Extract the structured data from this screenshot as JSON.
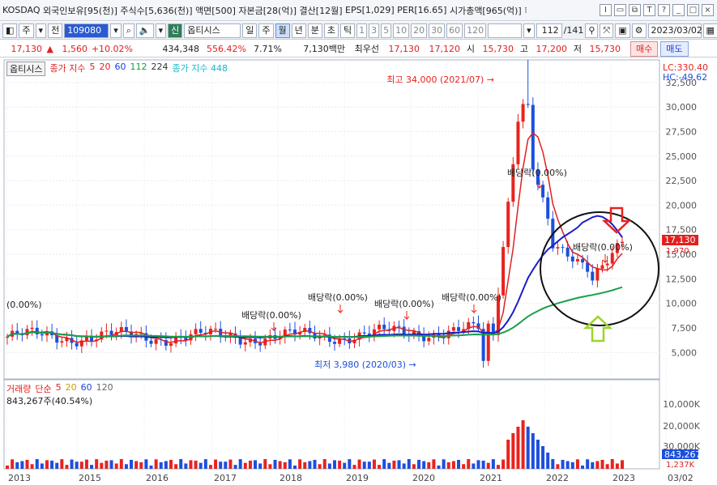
{
  "info": {
    "market": "KOSDAQ",
    "foreign": "외국인보유[95(천)]",
    "shares": "주식수[5,636(천)]",
    "par": "액면[500]",
    "capital": "자본금[28(억)]",
    "settle": "결산[12월]",
    "eps": "EPS[1,029]",
    "per": "PER[16.65]",
    "mcap": "시가총액[965(억)]",
    "tail": "⁝"
  },
  "toolbar": {
    "period_btn": "주",
    "prev_btn": "전",
    "code": "109080",
    "name": "옵티시스",
    "tag": "신",
    "periods": [
      "일",
      "주",
      "월",
      "년",
      "분",
      "초",
      "틱"
    ],
    "selected_period": "월",
    "nums": [
      "1",
      "3",
      "5",
      "10",
      "20",
      "30",
      "60",
      "120"
    ],
    "count": "112",
    "total": "/141",
    "date": "2023/03/02"
  },
  "quote": {
    "price": "17,130",
    "arrow": "▲",
    "change": "1,560",
    "rate": "+10.02%",
    "volume": "434,348",
    "vol_rate": "556.42%",
    "turnover": "7.71%",
    "amount": "7,130백만",
    "best_label": "최우선",
    "ask": "17,130",
    "bid": "17,120",
    "open_label": "시",
    "open": "15,730",
    "high_label": "고",
    "high": "17,200",
    "low_label": "저",
    "low": "15,730",
    "buy": "매수",
    "sell": "매도"
  },
  "legend": {
    "name": "옵티시스",
    "ma_label": "종가 지수",
    "ma": [
      "5",
      "20",
      "60",
      "112",
      "224"
    ],
    "ma2": "종가 지수 448"
  },
  "volume_legend": {
    "title": "거래량",
    "ma_label": "단순",
    "ma": [
      "5",
      "20",
      "60",
      "120"
    ],
    "current": "843,267주(40.54%)"
  },
  "annotations": {
    "high": "최고 34,000 (2021/07)",
    "low": "최저 3,980 (2020/03)",
    "div": "배당락(0.00%)",
    "first": "(0.00%)",
    "lc": "LC:330.40",
    "hc": "HC:-49.62",
    "price_tag": "17,130",
    "sub_tag": "1,970",
    "vol_tag": "843,267",
    "vol_tag2": "1,237K"
  },
  "colors": {
    "up": "#e8231e",
    "down": "#1d4fdc",
    "ma5": "#e02020",
    "ma20": "#1d1dc8",
    "ma60": "#18a048",
    "ma112": "#2a36b8",
    "accent": "#2a5bd0"
  },
  "chart_data": {
    "type": "candlestick",
    "x_labels": [
      "2013",
      "2015",
      "2016",
      "2017",
      "2018",
      "2019",
      "2020",
      "2021",
      "2022",
      "2023",
      "03/02"
    ],
    "y_ticks": [
      5000,
      7500,
      10000,
      12500,
      15000,
      17500,
      20000,
      22500,
      25000,
      27500,
      30000,
      32500
    ],
    "y_tick_labels": [
      "5,000",
      "7,500",
      "10,000",
      "12,500",
      "15,000",
      "17,500",
      "20,000",
      "22,500",
      "25,000",
      "27,500",
      "30,000",
      "32,500"
    ],
    "ylim": [
      2300,
      34800
    ],
    "volume_ticks": [
      "10,000K",
      "20,000K",
      "30,000K"
    ],
    "high_point": {
      "date": "2021/07",
      "value": 34000
    },
    "low_point": {
      "date": "2020/03",
      "value": 3980
    }
  }
}
